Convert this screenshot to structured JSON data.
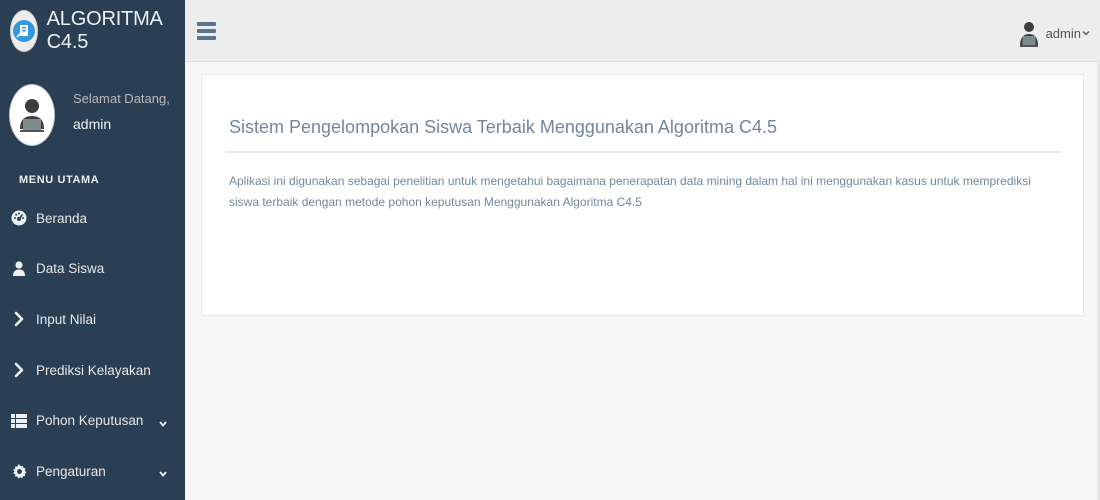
{
  "brand": {
    "title": "ALGORITMA C4.5",
    "logo_icon": "brand-logo-icon"
  },
  "profile": {
    "welcome": "Selamat Datang,",
    "name": "admin",
    "avatar_icon": "user-avatar-icon"
  },
  "sidebar": {
    "section_title": "MENU UTAMA",
    "items": [
      {
        "label": "Beranda",
        "icon": "dashboard-icon",
        "has_submenu": false
      },
      {
        "label": "Data Siswa",
        "icon": "user-icon",
        "has_submenu": false
      },
      {
        "label": "Input Nilai",
        "icon": "chevron-right-icon",
        "has_submenu": false
      },
      {
        "label": "Prediksi Kelayakan",
        "icon": "chevron-right-icon",
        "has_submenu": false
      },
      {
        "label": "Pohon Keputusan",
        "icon": "table-icon",
        "has_submenu": true
      },
      {
        "label": "Pengaturan",
        "icon": "gear-icon",
        "has_submenu": true
      }
    ]
  },
  "topnav": {
    "user_name": "admin",
    "menu_toggle_icon": "hamburger-icon"
  },
  "main": {
    "title": "Sistem Pengelompokan Siswa Terbaik Menggunakan Algoritma C4.5",
    "description": "Aplikasi ini digunakan sebagai penelitian untuk mengetahui bagaimana penerapatan data mining dalam hal ini menggunakan kasus untuk memprediksi siswa terbaik dengan metode pohon keputusan Menggunakan Algoritma C4.5"
  },
  "colors": {
    "sidebar_bg": "#2a3f54",
    "topnav_bg": "#ededed",
    "page_bg": "#f7f7f7",
    "text_muted": "#73879c"
  }
}
